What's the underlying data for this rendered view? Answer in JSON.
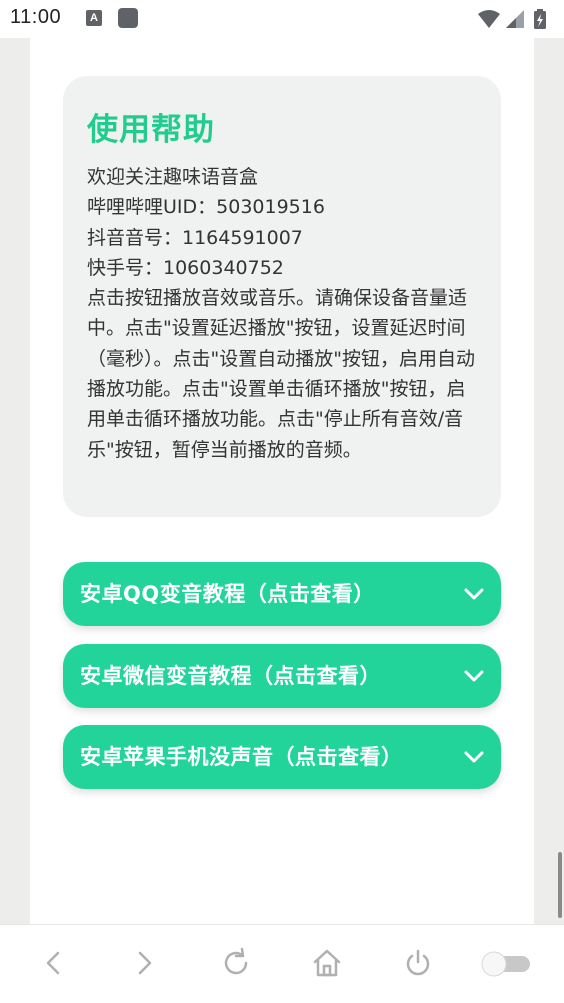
{
  "status_bar": {
    "time": "11:00",
    "notification_letter": "A"
  },
  "help": {
    "title": "使用帮助",
    "lines": [
      "欢迎关注趣味语音盒",
      "哔哩哔哩UID：503019516",
      "抖音音号：1164591007",
      "快手号：1060340752",
      "点击按钮播放音效或音乐。请确保设备音量适中。点击\"设置延迟播放\"按钮，设置延迟时间（毫秒）。点击\"设置自动播放\"按钮，启用自动播放功能。点击\"设置单击循环播放\"按钮，启用单击循环播放功能。点击\"停止所有音效/音乐\"按钮，暂停当前播放的音频。"
    ]
  },
  "accordions": [
    {
      "label": "安卓QQ变音教程（点击查看）"
    },
    {
      "label": "安卓微信变音教程（点击查看）"
    },
    {
      "label": "安卓苹果手机没声音（点击查看）"
    }
  ],
  "colors": {
    "accent": "#22d49a",
    "title": "#22cc8e",
    "card_bg": "#f0f2f1"
  },
  "nav_icons": [
    "back-icon",
    "forward-icon",
    "reload-icon",
    "home-icon",
    "power-icon",
    "toggle-icon"
  ]
}
